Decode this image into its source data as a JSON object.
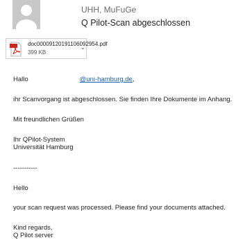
{
  "header": {
    "sender": "UHH, MuFuGe",
    "subject": "Q Pilot-Scan abgeschlossen"
  },
  "attachment": {
    "filename": "doc00009120191106092954.pdf",
    "size": "399 KB",
    "icon": "pdf-icon"
  },
  "body": {
    "greeting_de": "Hallo",
    "email_link": "@uni-hamburg.de",
    "email_suffix": ",",
    "line_de": "ihr Scanvorgang ist abgeschlossen. Sie finden Ihre Dokumente im Anhang.",
    "closing_de": "Mit freundlichen Grüßen",
    "sig_de_1": "Ihr QPilot-System",
    "sig_de_2": "Universität Hamburg",
    "divider": "-----------",
    "greeting_en": "Hello",
    "line_en": "your scan request was processed. Please find your documents attached.",
    "closing_en": "Kind regards,",
    "sig_en_1": "Q Pilot server"
  }
}
